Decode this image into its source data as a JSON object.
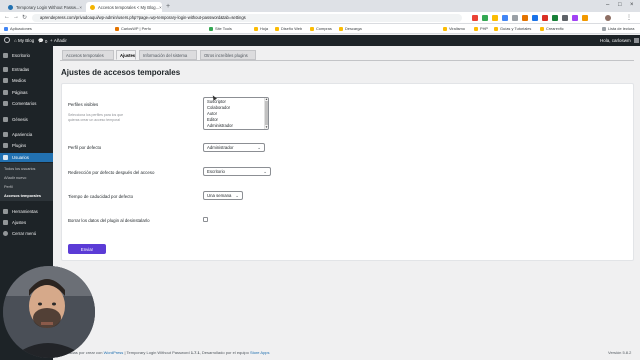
{
  "browser": {
    "tabs": [
      {
        "title": "Temporary Login Without Passw...",
        "active": false
      },
      {
        "title": "Accesos temporales < My Blog...",
        "active": true
      }
    ],
    "url": "aprendepress.com/privadoaqui/wp-admin/users.php?page=wp-temporary-login-without-password&tab=settings",
    "bookmarks": [
      "Aplicaciones",
      "CarlosWP | Perfo",
      "Site Tools",
      "Hoja",
      "Diseño Web",
      "Compras",
      "Descarga",
      "Viralismo",
      "PHP",
      "Guías y Tutoriales",
      "Crearexfic",
      "Lista de lectura"
    ]
  },
  "adminbar": {
    "site_name": "My Blog",
    "comments_count": "0",
    "new_label": "Añadir",
    "greeting": "Hola, carloswm"
  },
  "sidebar": {
    "items": [
      {
        "label": "Escritorio"
      },
      {
        "label": "Entradas"
      },
      {
        "label": "Medios"
      },
      {
        "label": "Páginas"
      },
      {
        "label": "Comentarios"
      },
      {
        "label": "Génesis"
      },
      {
        "label": "Apariencia"
      },
      {
        "label": "Plugins"
      },
      {
        "label": "Usuarios"
      },
      {
        "label": "Herramientas"
      },
      {
        "label": "Ajustes"
      },
      {
        "label": "Cerrar menú"
      }
    ],
    "submenu": [
      "Todos los usuarios",
      "Añadir nuevo",
      "Perfil",
      "Accesos temporales"
    ]
  },
  "tabs": [
    "Accesos temporales",
    "Ajustes",
    "Información del sistema",
    "Otros increíbles plugins"
  ],
  "page_title": "Ajustes de accesos temporales",
  "form": {
    "visible_profiles": {
      "label": "Perfiles visibles",
      "description": "Selecciona los perfiles para los que quieras crear un acceso temporal",
      "options": [
        "Suscriptor",
        "Colaborador",
        "Autor",
        "Editor",
        "Administrador"
      ]
    },
    "default_profile": {
      "label": "Perfil por defecto",
      "value": "Administrador"
    },
    "redirect": {
      "label": "Redirección por defecto después del acceso",
      "value": "Escritorio"
    },
    "expiry": {
      "label": "Tiempo de caducidad por defecto",
      "value": "Una semana"
    },
    "delete_data": {
      "label": "Borrar los datos del plugin al desinstalarlo",
      "checked": false
    },
    "submit_label": "Enviar"
  },
  "footer": {
    "text_prefix": "Gracias por crear con",
    "wp_link": "WordPress",
    "text_mid": "| Temporary Login Without Password",
    "plugin_version": "1.7.1",
    "text_after": ", Desarrollado por el equipo",
    "store_link": "Store Apps",
    "version": "Versión 5.8.2"
  }
}
